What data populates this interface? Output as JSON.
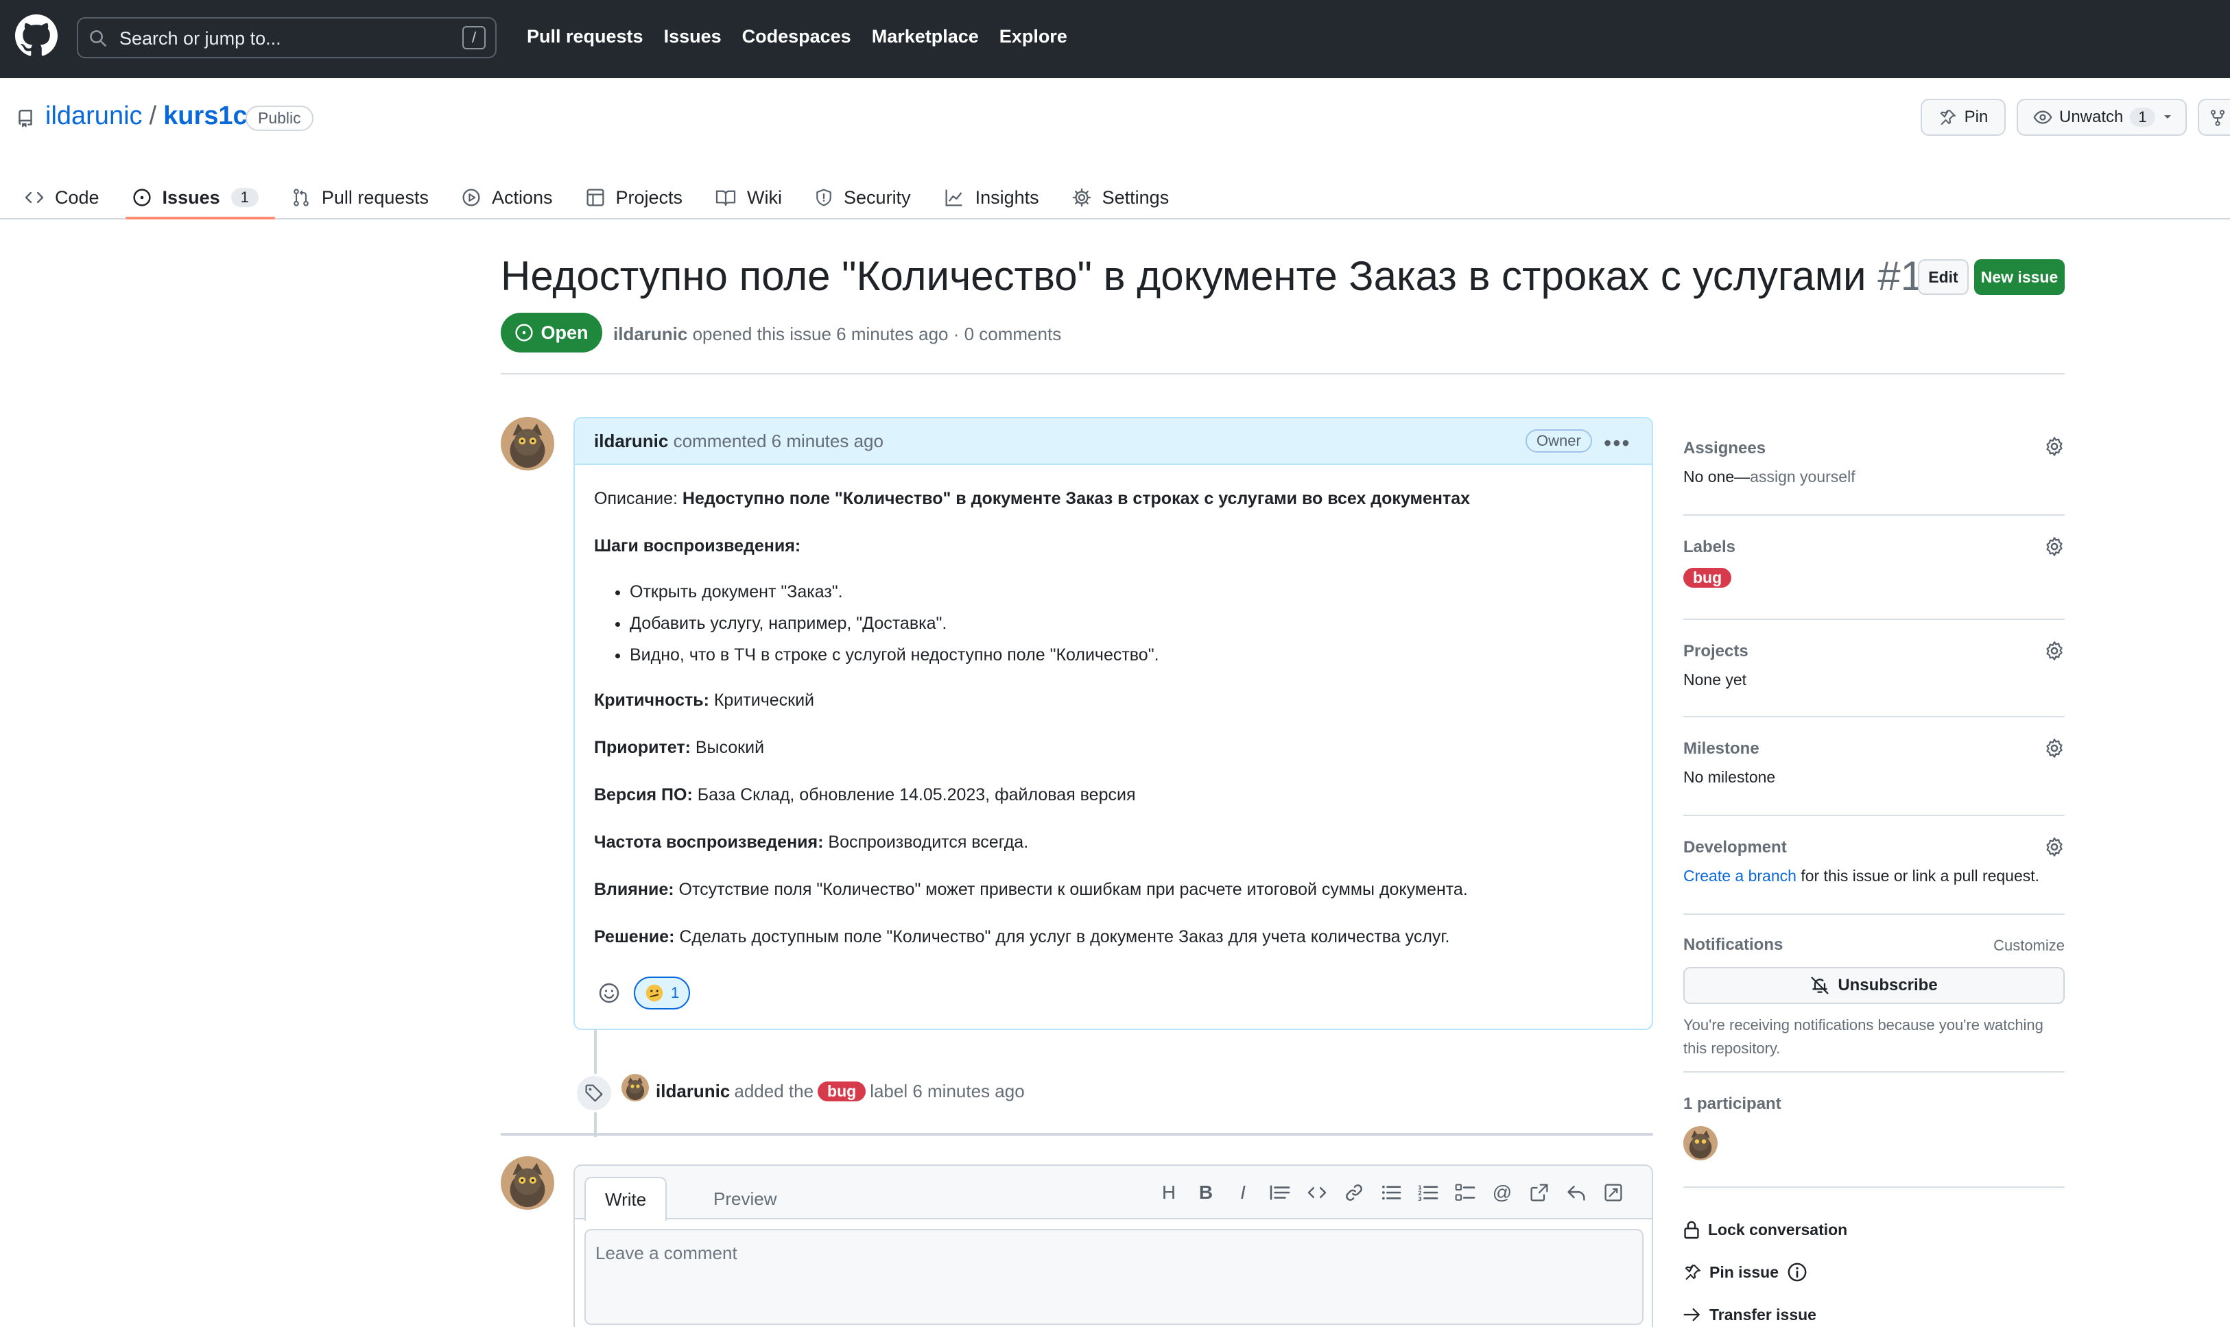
{
  "header": {
    "search_placeholder": "Search or jump to...",
    "search_key": "/",
    "nav": [
      "Pull requests",
      "Issues",
      "Codespaces",
      "Marketplace",
      "Explore"
    ]
  },
  "repo": {
    "owner": "ildarunic",
    "separator": "/",
    "name": "kurs1c",
    "visibility": "Public",
    "pin_label": "Pin",
    "watch_label": "Unwatch",
    "watch_count": "1",
    "tabs": [
      {
        "label": "Code",
        "icon": "code-icon"
      },
      {
        "label": "Issues",
        "icon": "issue-opened-icon",
        "count": "1"
      },
      {
        "label": "Pull requests",
        "icon": "git-pull-request-icon"
      },
      {
        "label": "Actions",
        "icon": "play-icon"
      },
      {
        "label": "Projects",
        "icon": "table-icon"
      },
      {
        "label": "Wiki",
        "icon": "book-icon"
      },
      {
        "label": "Security",
        "icon": "shield-icon"
      },
      {
        "label": "Insights",
        "icon": "graph-icon"
      },
      {
        "label": "Settings",
        "icon": "gear-icon"
      }
    ]
  },
  "issue": {
    "title": "Недоступно поле \"Количество\" в документе Заказ в строках с услугами",
    "number": "#1",
    "edit_label": "Edit",
    "new_issue_label": "New issue",
    "state": "Open",
    "author": "ildarunic",
    "meta_rest": " opened this issue 6 minutes ago · 0 comments"
  },
  "comment": {
    "author": "ildarunic",
    "time": " commented 6 minutes ago",
    "badge": "Owner",
    "desc_label": "Описание: ",
    "desc_value": "Недоступно поле \"Количество\" в документе Заказ в строках с услугами во всех документах",
    "steps_title": "Шаги воспроизведения:",
    "steps": [
      "Открыть документ \"Заказ\".",
      "Добавить услугу, например, \"Доставка\".",
      "Видно, что в ТЧ в строке с услугой недоступно поле \"Количество\"."
    ],
    "fields": [
      {
        "label": "Критичность:",
        "value": " Критический"
      },
      {
        "label": "Приоритет:",
        "value": " Высокий"
      },
      {
        "label": "Версия ПО:",
        "value": " База Склад, обновление 14.05.2023, файловая версия"
      },
      {
        "label": "Частота воспроизведения:",
        "value": " Воспроизводится всегда."
      },
      {
        "label": "Влияние:",
        "value": " Отсутствие поля \"Количество\" может привести к ошибкам при расчете итоговой суммы документа."
      },
      {
        "label": "Решение:",
        "value": " Сделать доступным поле \"Количество\" для услуг в документе Заказ для учета количества услуг."
      }
    ],
    "reaction_count": "1"
  },
  "event": {
    "actor": "ildarunic",
    "pre": "added the",
    "label": "bug",
    "post": "label 6 minutes ago"
  },
  "composer": {
    "write_tab": "Write",
    "preview_tab": "Preview",
    "placeholder": "Leave a comment"
  },
  "sidebar": {
    "assignees_title": "Assignees",
    "assignees_value": "No one—",
    "assignees_link": "assign yourself",
    "labels_title": "Labels",
    "label": "bug",
    "projects_title": "Projects",
    "projects_value": "None yet",
    "milestone_title": "Milestone",
    "milestone_value": "No milestone",
    "development_title": "Development",
    "development_link": "Create a branch",
    "development_rest": " for this issue or link a pull request.",
    "notifications_title": "Notifications",
    "customize": "Customize",
    "unsubscribe": "Unsubscribe",
    "notifications_note": "You're receiving notifications because you're watching this repository.",
    "participants_title": "1 participant",
    "lock": "Lock conversation",
    "pin": "Pin issue",
    "transfer": "Transfer issue"
  },
  "colors": {
    "header_bg": "#24292f",
    "open_green": "#1f883d",
    "bug_red": "#d73a4a",
    "link_blue": "#0969da",
    "tab_underline": "#fd8c73"
  }
}
